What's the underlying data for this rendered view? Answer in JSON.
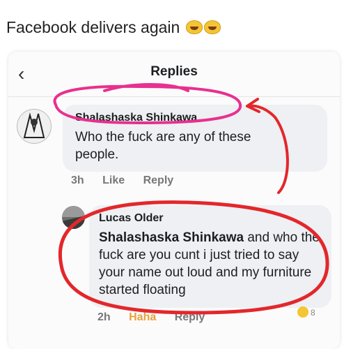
{
  "caption": "Facebook delivers again",
  "header": {
    "back_icon": "chevron-left-icon",
    "title": "Replies"
  },
  "comment": {
    "author": "Shalashaska Shinkawa",
    "text": "Who the fuck are any of these people.",
    "time": "3h",
    "like_label": "Like",
    "reply_label": "Reply"
  },
  "reply": {
    "author": "Lucas Older",
    "mention": "Shalashaska Shinkawa",
    "text": "and who the fuck are you cunt i just tried to say your name out loud and my furniture started floating",
    "time": "2h",
    "reaction_label": "Haha",
    "reply_label": "Reply",
    "reaction_count": "8"
  },
  "colors": {
    "highlight_pink": "#e8308f",
    "circle_red": "#e3272b",
    "link_blue": "#385898"
  }
}
